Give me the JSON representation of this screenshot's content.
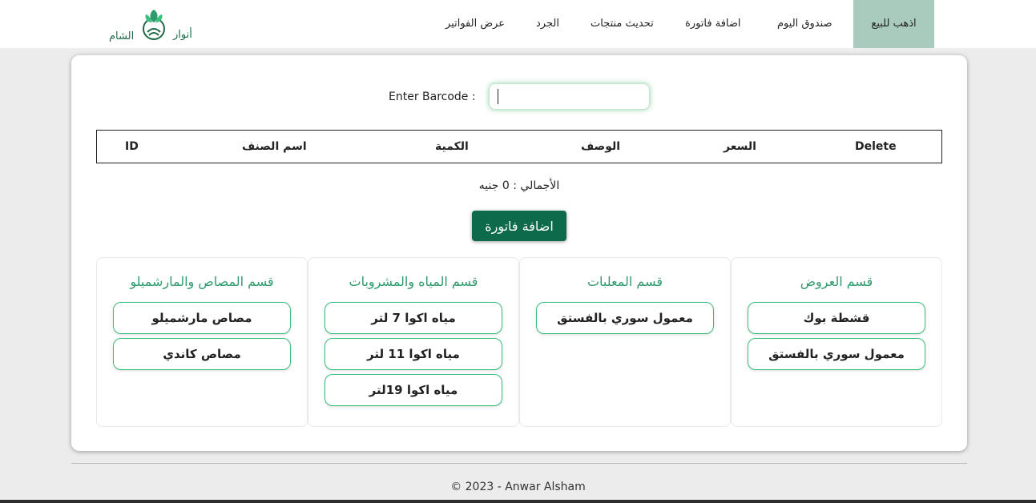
{
  "brand": {
    "left_word": "الشام",
    "right_word": "أنوار"
  },
  "nav": {
    "items": [
      "اذهب للبيع",
      "صندوق اليوم",
      "اضافة فاتورة",
      "تحديث منتجات",
      "الجرد",
      "عرض الفواتير"
    ],
    "active_index": 0
  },
  "barcode": {
    "label": "Enter Barcode :",
    "value": ""
  },
  "table": {
    "headers": [
      "Delete",
      "السعر",
      "الوصف",
      "الكمية",
      "اسم الصنف",
      "ID"
    ]
  },
  "total": "الأجمالي : 0 جنيه",
  "add_invoice_label": "اضافة فاتورة",
  "sections": [
    {
      "title": "قسم العروض",
      "products": [
        "قشطة بوك",
        "معمول سوري بالفستق"
      ]
    },
    {
      "title": "قسم المعلبات",
      "products": [
        "معمول سوري بالفستق"
      ]
    },
    {
      "title": "قسم المياه والمشروبات",
      "products": [
        "مياه اكوا 7 لتر",
        "مياه اكوا 11 لتر",
        "مياه اكوا 19لتر"
      ]
    },
    {
      "title": "قسم المصاص والمارشميلو",
      "products": [
        "مصاص مارشميلو",
        "مصاص كاندي"
      ]
    }
  ],
  "footer": "© 2023 - Anwar Alsham",
  "colors": {
    "accent": "#0d6a4a",
    "active_nav": "#a8cbbd",
    "section_title": "#2e9b6c",
    "button_border": "#3bbf7c"
  }
}
